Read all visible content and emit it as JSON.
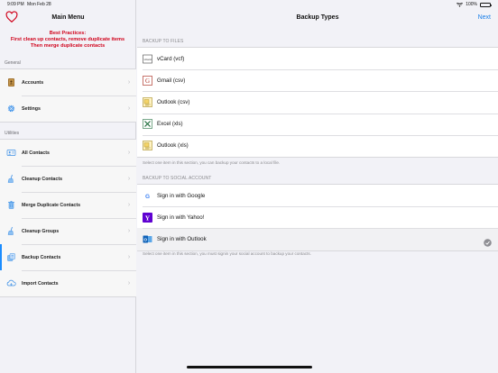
{
  "status": {
    "time": "9:09 PM",
    "date": "Mon Feb 28",
    "battery": "100%"
  },
  "sidebar": {
    "title": "Main Menu",
    "practices": [
      "Best Practices:",
      "First clean up contacts, remove duplicate items",
      "Then merge duplicate contacts"
    ],
    "general_label": "General",
    "general_items": [
      {
        "label": "Accounts",
        "icon": "contacts-book-icon"
      },
      {
        "label": "Settings",
        "icon": "gear-icon"
      }
    ],
    "utilities_label": "Utilities",
    "utility_items": [
      {
        "label": "All Contacts",
        "icon": "contact-card-icon"
      },
      {
        "label": "Cleanup Contacts",
        "icon": "broom-icon"
      },
      {
        "label": "Merge Duplicate Contacts",
        "icon": "trash-icon"
      },
      {
        "label": "Cleanup Groups",
        "icon": "broom-icon"
      },
      {
        "label": "Backup Contacts",
        "icon": "backup-icon",
        "selected": true
      },
      {
        "label": "Import Contacts",
        "icon": "cloud-icon"
      }
    ]
  },
  "main": {
    "title": "Backup Types",
    "next_label": "Next",
    "files_section": "BACKUP TO FILES",
    "file_types": [
      {
        "label": "vCard (vcf)",
        "icon": "vcard-icon"
      },
      {
        "label": "Gmail (csv)",
        "icon": "gmail-icon"
      },
      {
        "label": "Outlook (csv)",
        "icon": "outlook-csv-icon"
      },
      {
        "label": "Excel (xls)",
        "icon": "excel-icon"
      },
      {
        "label": "Outlook (xls)",
        "icon": "outlook-xls-icon"
      }
    ],
    "files_footer": "Select one item in this section, you can backup your contacts to a local file.",
    "social_section": "BACKUP TO SOCIAL ACCOUNT",
    "social_accounts": [
      {
        "label": "Sign in with Google",
        "icon": "google-icon"
      },
      {
        "label": "Sign in with Yahoo!",
        "icon": "yahoo-icon"
      },
      {
        "label": "Sign in with Outlook",
        "icon": "outlook-icon",
        "selected": true
      }
    ],
    "social_footer": "Select one item in this section, you must signin your social account to backup your contacts."
  },
  "colors": {
    "accent": "#1a7fe8",
    "warning": "#d0021b",
    "selection": "#1a8cff"
  }
}
